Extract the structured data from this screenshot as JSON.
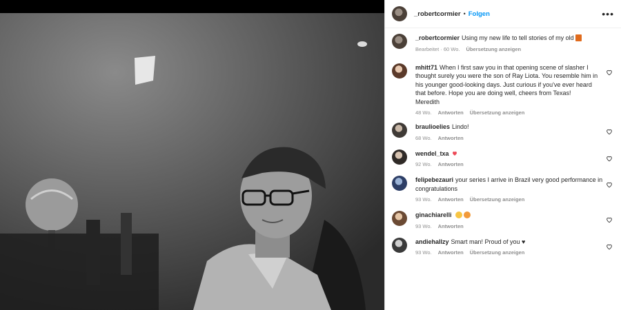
{
  "post": {
    "username": "_robertcormier",
    "follow_label": "Folgen",
    "separator": "•",
    "more_label": "•••",
    "caption": "Using my new life to tell stories of my old",
    "caption_meta": [
      "Bearbeitet · 60 Wo.",
      "Übersetzung anzeigen"
    ]
  },
  "comments": [
    {
      "user": "mhitt71",
      "text": "When I first saw you in that opening scene of slasher I thought surely you were the son of Ray Liota. You resemble him in his younger good-looking days. Just curious if you've ever heard that before. Hope you are doing well, cheers from Texas!",
      "extra": "Meredith",
      "time": "48 Wo.",
      "reply": "Antworten",
      "translate": "Übersetzung anzeigen"
    },
    {
      "user": "braulioelies",
      "text": "Lindo!",
      "time": "68 Wo.",
      "reply": "Antworten"
    },
    {
      "user": "wendel_txa",
      "text": "",
      "time": "92 Wo.",
      "reply": "Antworten"
    },
    {
      "user": "felipebezauri",
      "text": "your series I arrive in Brazil very good performance in congratulations",
      "time": "93 Wo.",
      "reply": "Antworten",
      "translate": "Übersetzung anzeigen"
    },
    {
      "user": "ginachiarelli",
      "text": "",
      "time": "93 Wo.",
      "reply": "Antworten"
    },
    {
      "user": "andiehallzy",
      "text": "Smart man! Proud of you ♥",
      "time": "93 Wo.",
      "reply": "Antworten",
      "translate": "Übersetzung anzeigen"
    }
  ],
  "colors": {
    "accent": "#0095f6",
    "muted": "#8e8e8e",
    "heart_red": "#ed4956"
  }
}
